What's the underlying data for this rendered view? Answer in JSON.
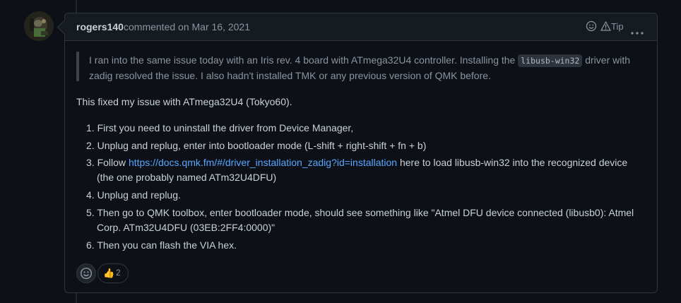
{
  "comment": {
    "author": "rogers140",
    "meta": "commented on Mar 16, 2021",
    "tip_label": "Tip",
    "quote": {
      "part1": "I ran into the same issue today with an Iris rev. 4 board with ATmega32U4 controller. Installing the",
      "code": "libusb-win32",
      "part2": "driver with",
      "line2": "zadig resolved the issue. I also hadn't installed TMK or any previous version of QMK before."
    },
    "intro": "This fixed my issue with ATmega32U4 (Tokyo60).",
    "steps": [
      {
        "num": "1.",
        "text": "First you need to uninstall the driver from Device Manager,"
      },
      {
        "num": "2.",
        "text": "Unplug and replug, enter into bootloader mode (L-shift + right-shift + fn + b)"
      },
      {
        "num": "3.",
        "prefix": "Follow",
        "link": "https://docs.qmk.fm/#/driver_installation_zadig?id=installation",
        "suffix": "here to load libusb-win32 into the recognized device",
        "line2": "(the one probably named ATm32U4DFU)"
      },
      {
        "num": "4.",
        "text": "Unplug and replug."
      },
      {
        "num": "5.",
        "text": "Then go to QMK toolbox, enter bootloader mode, should see something like \"Atmel DFU device connected (libusb0): Atmel",
        "line2": "Corp. ATm32U4DFU (03EB:2FF4:0000)\""
      },
      {
        "num": "6.",
        "text": "Then you can flash the VIA hex."
      }
    ],
    "reactions": [
      {
        "emoji": "👍",
        "count": "2"
      }
    ]
  },
  "icons": {
    "add_reaction": "smiley-icon",
    "tip": "alert-triangle-icon",
    "more": "kebab-horizontal-icon"
  },
  "colors": {
    "background": "#0d1117",
    "header": "#161b22",
    "border": "#30363d",
    "text": "#c9d1d9",
    "muted": "#8b949e",
    "link": "#58a6ff"
  }
}
